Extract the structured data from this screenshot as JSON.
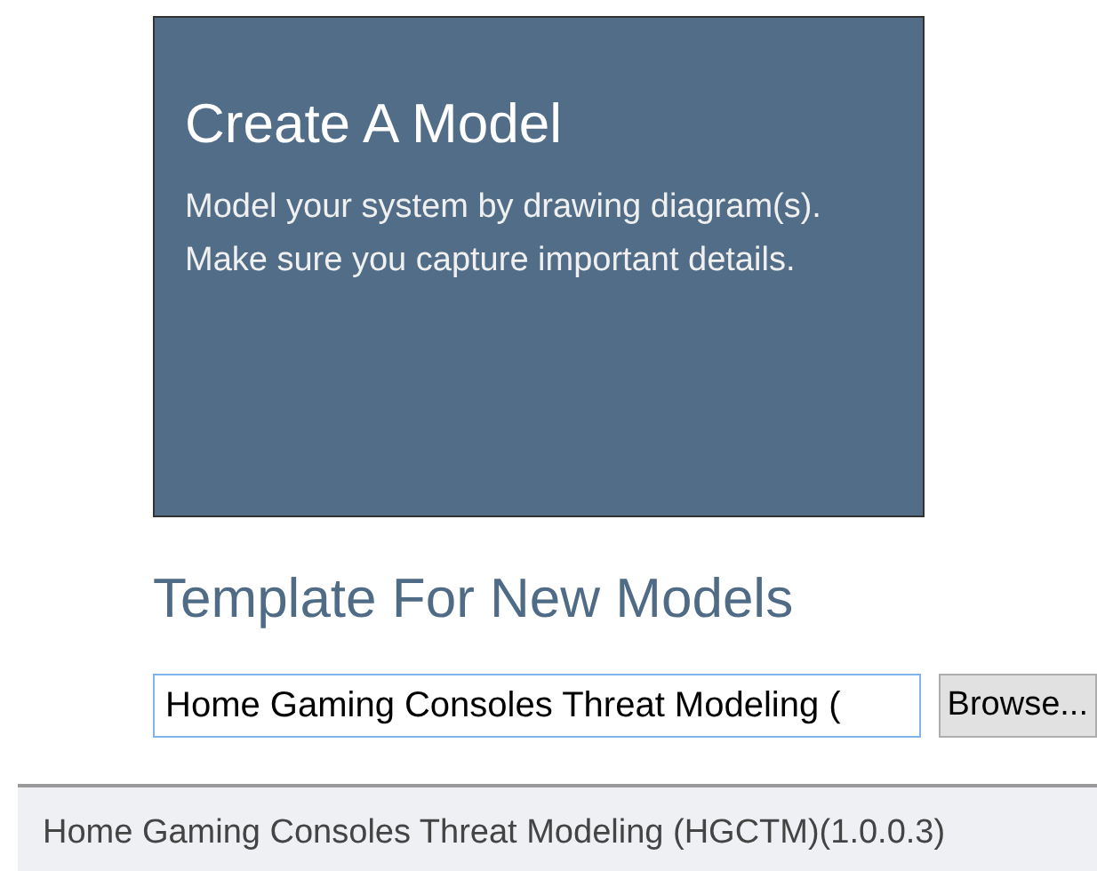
{
  "card": {
    "title": "Create A Model",
    "description": "Model your system by drawing diagram(s). Make sure you capture important details."
  },
  "template_section": {
    "heading": "Template For New Models",
    "template_field": {
      "value": "Home Gaming Consoles Threat Modeling ("
    },
    "browse_button": "Browse..."
  },
  "dropdown": {
    "items": [
      {
        "label": "Home Gaming Consoles Threat Modeling (HGCTM)(1.0.0.3)"
      }
    ]
  }
}
